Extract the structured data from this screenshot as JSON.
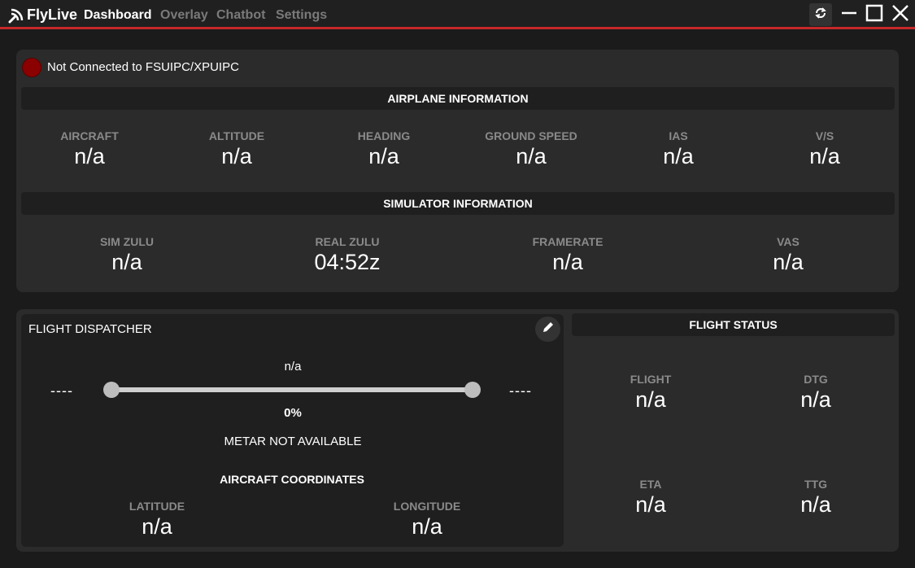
{
  "app": {
    "name": "FlyLive",
    "nav": [
      "Dashboard",
      "Overlay",
      "Chatbot",
      "Settings"
    ]
  },
  "connection": {
    "status_text": "Not Connected to FSUIPC/XPUIPC",
    "status_color": "#8b0000"
  },
  "airplane_info": {
    "header": "AIRPLANE INFORMATION",
    "metrics": [
      {
        "label": "AIRCRAFT",
        "value": "n/a"
      },
      {
        "label": "ALTITUDE",
        "value": "n/a"
      },
      {
        "label": "HEADING",
        "value": "n/a"
      },
      {
        "label": "GROUND SPEED",
        "value": "n/a"
      },
      {
        "label": "IAS",
        "value": "n/a"
      },
      {
        "label": "V/S",
        "value": "n/a"
      }
    ]
  },
  "simulator_info": {
    "header": "SIMULATOR INFORMATION",
    "metrics": [
      {
        "label": "SIM ZULU",
        "value": "n/a"
      },
      {
        "label": "REAL ZULU",
        "value": "04:52z"
      },
      {
        "label": "FRAMERATE",
        "value": "n/a"
      },
      {
        "label": "VAS",
        "value": "n/a"
      }
    ]
  },
  "dispatcher": {
    "title": "FLIGHT DISPATCHER",
    "route": "n/a",
    "origin": "----",
    "destination": "----",
    "progress_text": "0%",
    "progress": 0,
    "metar": "METAR NOT AVAILABLE"
  },
  "coordinates": {
    "header": "AIRCRAFT COORDINATES",
    "metrics": [
      {
        "label": "LATITUDE",
        "value": "n/a"
      },
      {
        "label": "LONGITUDE",
        "value": "n/a"
      }
    ]
  },
  "flight_status": {
    "header": "FLIGHT STATUS",
    "metrics": [
      {
        "label": "FLIGHT",
        "value": "n/a"
      },
      {
        "label": "DTG",
        "value": "n/a"
      },
      {
        "label": "ETA",
        "value": "n/a"
      },
      {
        "label": "TTG",
        "value": "n/a"
      }
    ]
  },
  "colors": {
    "accent": "#c62828",
    "background": "#1b1b1b",
    "panel": "#2b2b2b"
  },
  "icons": [
    "flylive-logo-icon",
    "refresh-icon",
    "minimize-icon",
    "maximize-icon",
    "close-icon",
    "pencil-icon"
  ]
}
